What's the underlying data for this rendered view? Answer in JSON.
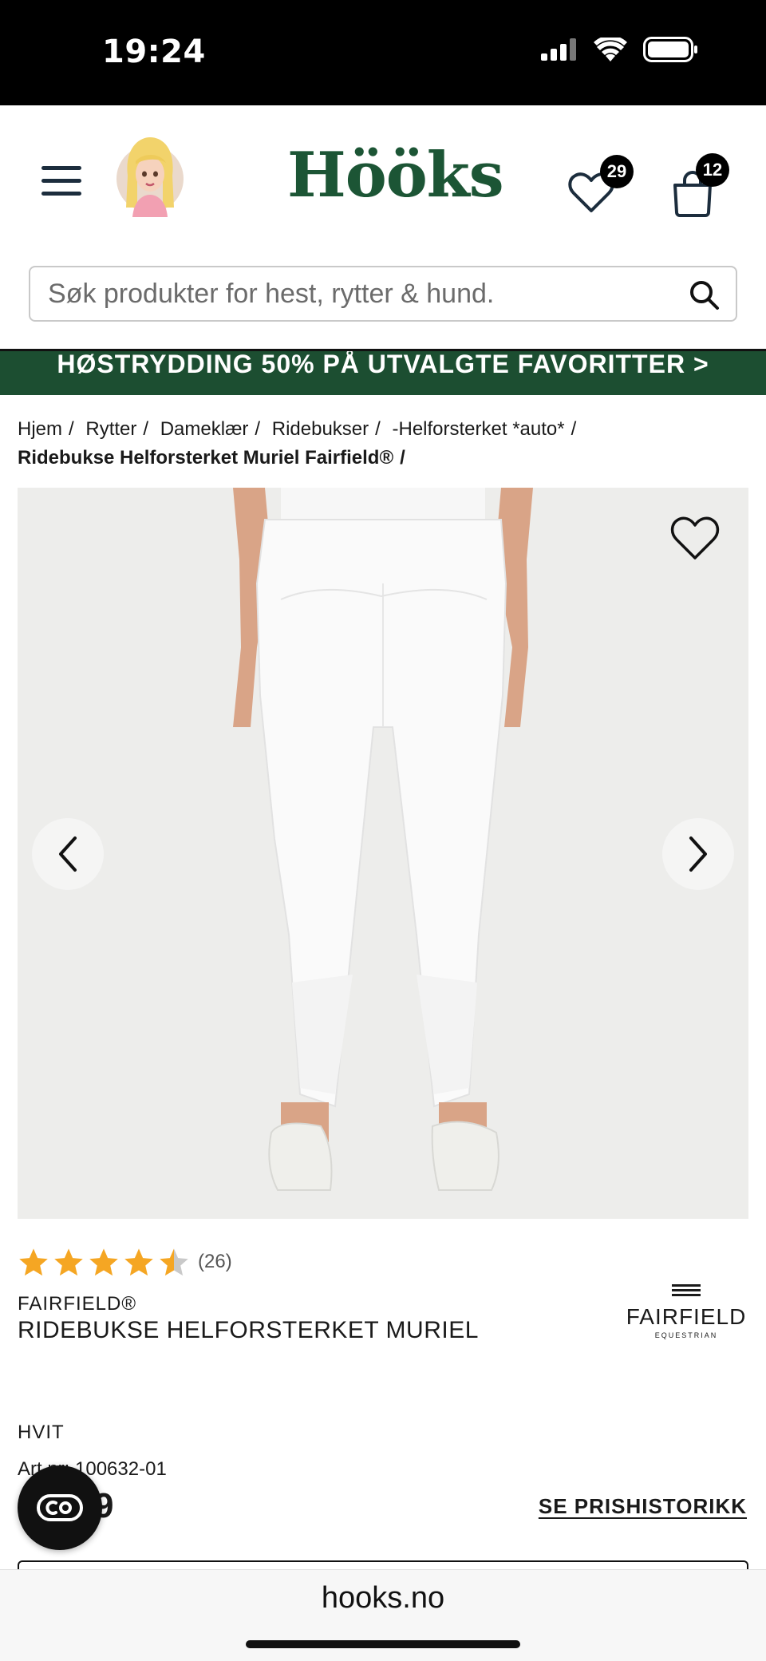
{
  "status_bar": {
    "time": "19:24"
  },
  "header": {
    "logo": "Hööks",
    "wishlist_count": "29",
    "cart_count": "12"
  },
  "search": {
    "placeholder": "Søk produkter for hest, rytter & hund."
  },
  "promo": {
    "text": "HØSTRYDDING 50% PÅ UTVALGTE FAVORITTER >"
  },
  "breadcrumb": {
    "items": [
      "Hjem",
      "Rytter",
      "Dameklær",
      "Ridebukser",
      "-Helforsterket *auto*"
    ],
    "current": "Ridebukse Helforsterket Muriel Fairfield®"
  },
  "product": {
    "rating": 4.5,
    "review_count": "(26)",
    "brand": "FAIRFIELD®",
    "title": "RIDEBUKSE HELFORSTERKET MURIEL",
    "brand_logo_name": "FAIRFIELD",
    "brand_logo_sub": "EQUESTRIAN",
    "color": "HVIT",
    "artnr": "Art.nr: 100632-01",
    "price_partial": "9",
    "price_history_label": "SE PRISHISTORIKK"
  },
  "browser": {
    "url": "hooks.no"
  },
  "colors": {
    "brand_green": "#1c5535",
    "promo_green": "#1c4e31",
    "star": "#f5a623"
  }
}
